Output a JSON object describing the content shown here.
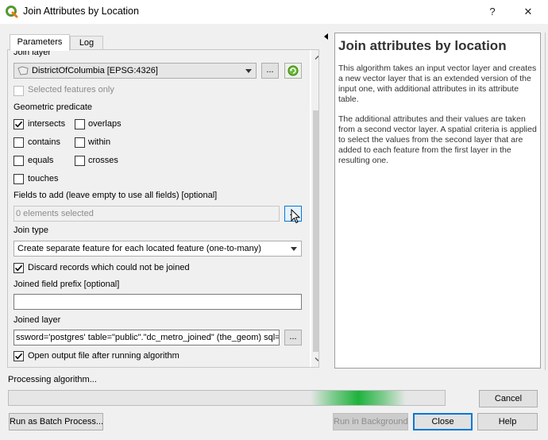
{
  "window": {
    "title": "Join Attributes by Location",
    "help_glyph": "?",
    "close_glyph": "✕"
  },
  "tabs": [
    {
      "label": "Parameters"
    },
    {
      "label": "Log"
    }
  ],
  "form": {
    "join_layer_label": "Join layer",
    "join_layer_value": "DistrictOfColumbia [EPSG:4326]",
    "ellipsis": "...",
    "selected_only_label": "Selected features only",
    "geometric_predicate_label": "Geometric predicate",
    "predicates": {
      "intersects": {
        "label": "intersects",
        "checked": true
      },
      "overlaps": {
        "label": "overlaps",
        "checked": false
      },
      "contains": {
        "label": "contains",
        "checked": false
      },
      "within": {
        "label": "within",
        "checked": false
      },
      "equals": {
        "label": "equals",
        "checked": false
      },
      "crosses": {
        "label": "crosses",
        "checked": false
      },
      "touches": {
        "label": "touches",
        "checked": false
      }
    },
    "fields_label": "Fields to add (leave empty to use all fields) [optional]",
    "fields_value": "0 elements selected",
    "join_type_label": "Join type",
    "join_type_value": "Create separate feature for each located feature (one-to-many)",
    "discard_label": "Discard records which could not be joined",
    "discard_checked": true,
    "prefix_label": "Joined field prefix [optional]",
    "prefix_value": "",
    "joined_layer_label": "Joined layer",
    "joined_layer_value": "ssword='postgres' table=\"public\".\"dc_metro_joined\" (the_geom) sql=",
    "open_output_label": "Open output file after running algorithm",
    "open_output_checked": true
  },
  "help": {
    "title": "Join attributes by location",
    "p1": "This algorithm takes an input vector layer and creates a new vector layer that is an extended version of the input one, with additional attributes in its attribute table.",
    "p2": "The additional attributes and their values are taken from a second vector layer. A spatial criteria is applied to select the values from the second layer that are added to each feature from the first layer in the resulting one."
  },
  "status": {
    "text": "Processing algorithm..."
  },
  "buttons": {
    "cancel": "Cancel",
    "batch": "Run as Batch Process...",
    "background": "Run in Background",
    "close": "Close",
    "help": "Help"
  },
  "colors": {
    "accent": "#0078d7",
    "progress_glow": "#1db33c",
    "qgis_green": "#589632"
  }
}
